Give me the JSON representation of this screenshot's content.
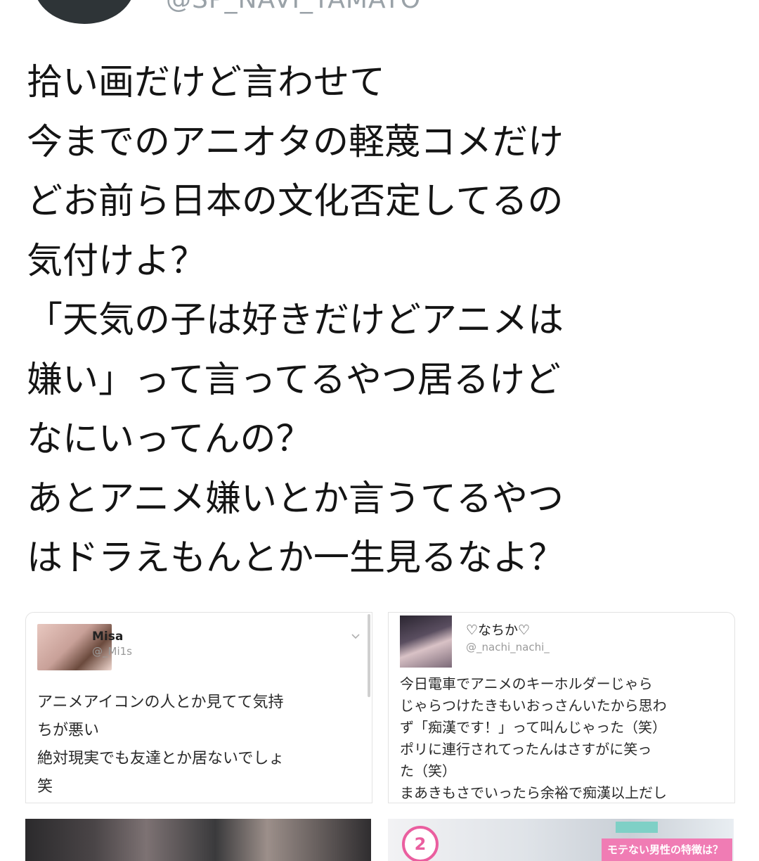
{
  "tweet": {
    "handle": "@SP_NAVI_YAMATO",
    "lines": [
      "拾い画だけど言わせて",
      "今までのアニオタの軽蔑コメだけ",
      "どお前ら日本の文化否定してるの",
      "気付けよ？",
      "「天気の子は好きだけどアニメは",
      "嫌い」って言ってるやつ居るけど",
      "なにいってんの？",
      "あとアニメ嫌いとか言うてるやつ",
      "はドラえもんとか一生見るなよ？"
    ]
  },
  "media": {
    "card1": {
      "name": "Misa",
      "handle": "@_Mi1s",
      "lines": [
        "アニメアイコンの人とか見てて気持",
        "ちが悪い",
        "絶対現実でも友達とか居ないでしょ",
        "笑"
      ]
    },
    "card2": {
      "name": "♡なちか♡",
      "handle": "@_nachi_nachi_",
      "lines": [
        "今日電車でアニメのキーホルダーじゃら",
        "じゃらつけたきもいおっさんいたから思わ",
        "ず「痴漢です！」って叫んじゃった（笑）",
        "ポリに連行されてったんはさすがに笑っ",
        "た（笑）",
        "まあきもさでいったら余裕で痴漢以上だし"
      ]
    },
    "photo2": {
      "badge": "2",
      "tag": "",
      "caption": "モテない男性の特徴は？"
    }
  },
  "icons": {
    "card_menu": "chevron-down-icon"
  }
}
